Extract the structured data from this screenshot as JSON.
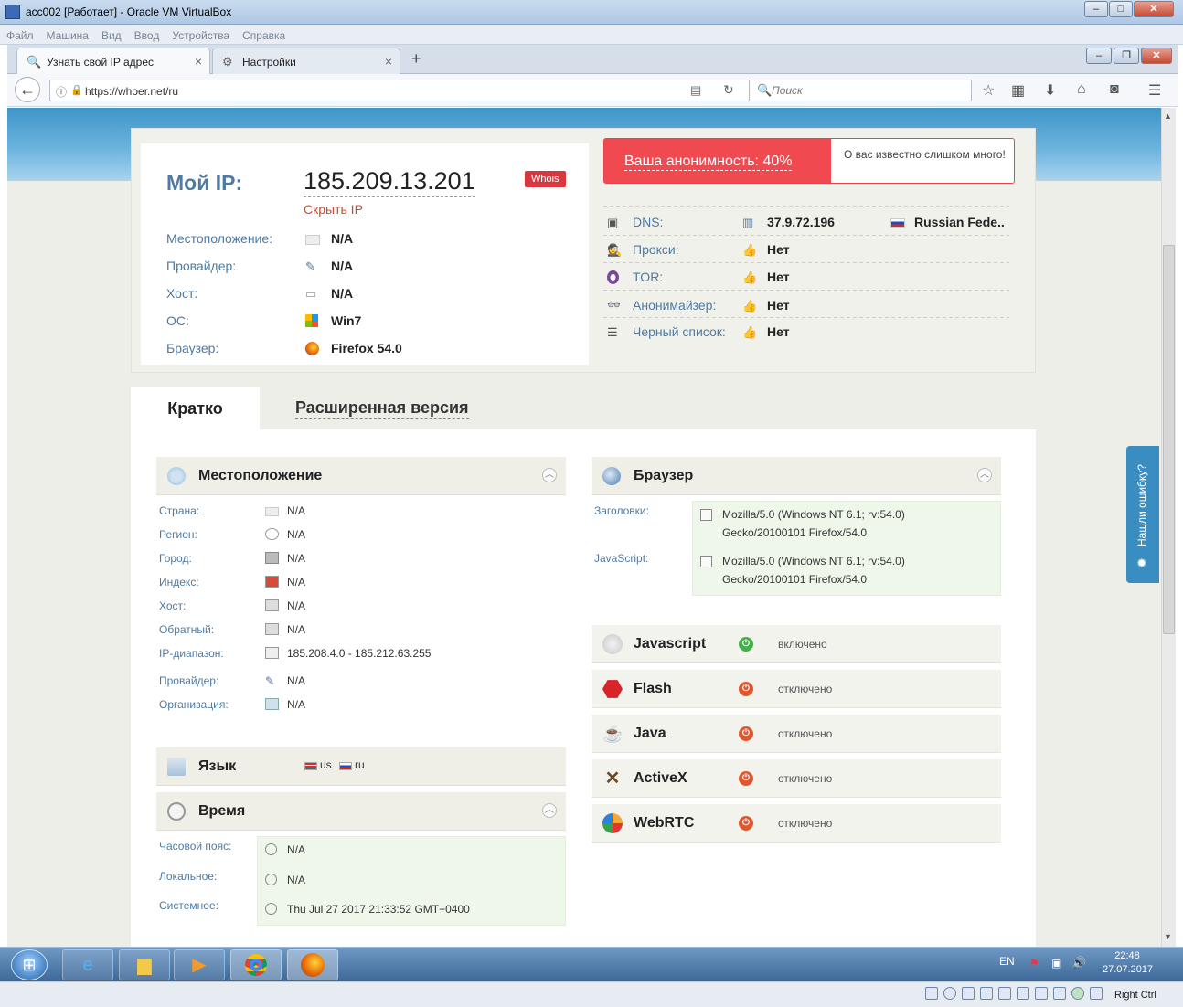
{
  "window": {
    "title": "acc002 [Работает] - Oracle VM VirtualBox",
    "menu": [
      "Файл",
      "Машина",
      "Вид",
      "Ввод",
      "Устройства",
      "Справка"
    ]
  },
  "browser": {
    "tabs": [
      {
        "label": "Узнать свой IP адрес"
      },
      {
        "label": "Настройки"
      }
    ],
    "url": "https://whoer.net/ru",
    "search_placeholder": "Поиск"
  },
  "ipcard": {
    "my_ip_label": "Мой IP:",
    "ip": "185.209.13.201",
    "hide_ip": "Скрыть IP",
    "whois": "Whois",
    "rows": [
      {
        "k": "Местоположение:",
        "v": "N/A"
      },
      {
        "k": "Провайдер:",
        "v": "N/A"
      },
      {
        "k": "Хост:",
        "v": "N/A"
      },
      {
        "k": "ОС:",
        "v": "Win7"
      },
      {
        "k": "Браузер:",
        "v": "Firefox 54.0"
      }
    ],
    "anonymity": "Ваша анонимность: 40%",
    "anonymity_tip": "О вас известно слишком много!",
    "right_rows": [
      {
        "k": "DNS:",
        "v": "37.9.72.196",
        "extra": "Russian Fede.."
      },
      {
        "k": "Прокси:",
        "v": "Нет"
      },
      {
        "k": "TOR:",
        "v": "Нет"
      },
      {
        "k": "Анонимайзер:",
        "v": "Нет"
      },
      {
        "k": "Черный список:",
        "v": "Нет"
      }
    ]
  },
  "tabs": {
    "short": "Кратко",
    "extended": "Расширенная версия"
  },
  "location": {
    "title": "Местоположение",
    "rows": [
      {
        "k": "Страна:",
        "v": "N/A"
      },
      {
        "k": "Регион:",
        "v": "N/A"
      },
      {
        "k": "Город:",
        "v": "N/A"
      },
      {
        "k": "Индекс:",
        "v": "N/A"
      },
      {
        "k": "Хост:",
        "v": "N/A"
      },
      {
        "k": "Обратный:",
        "v": "N/A"
      },
      {
        "k": "IP-диапазон:",
        "v": "185.208.4.0 - 185.212.63.255"
      },
      {
        "k": "Провайдер:",
        "v": "N/A"
      },
      {
        "k": "Организация:",
        "v": "N/A"
      }
    ]
  },
  "language": {
    "title": "Язык",
    "langs": [
      "us",
      "ru"
    ]
  },
  "time": {
    "title": "Время",
    "rows": [
      {
        "k": "Часовой пояс:",
        "v": "N/A"
      },
      {
        "k": "Локальное:",
        "v": "N/A"
      },
      {
        "k": "Системное:",
        "v": "Thu Jul 27 2017 21:33:52 GMT+0400"
      }
    ]
  },
  "browser_sec": {
    "title": "Браузер",
    "headers_label": "Заголовки:",
    "headers_line1": "Mozilla/5.0 (Windows NT 6.1; rv:54.0)",
    "headers_line2": "Gecko/20100101 Firefox/54.0",
    "js_label": "JavaScript:",
    "js_line1": "Mozilla/5.0 (Windows NT 6.1; rv:54.0)",
    "js_line2": "Gecko/20100101 Firefox/54.0"
  },
  "plugins": [
    {
      "name": "Javascript",
      "status": "включено",
      "on": true
    },
    {
      "name": "Flash",
      "status": "отключено",
      "on": false
    },
    {
      "name": "Java",
      "status": "отключено",
      "on": false
    },
    {
      "name": "ActiveX",
      "status": "отключено",
      "on": false
    },
    {
      "name": "WebRTC",
      "status": "отключено",
      "on": false
    }
  ],
  "error_tab": "Нашли ошибку?",
  "taskbar": {
    "lang": "EN",
    "time": "22:48",
    "date": "27.07.2017"
  },
  "status": {
    "host_key": "Right Ctrl"
  },
  "colors": {
    "accent": "#4e7aa4",
    "danger": "#f04a50",
    "on": "#43b049",
    "off": "#e0562e"
  }
}
